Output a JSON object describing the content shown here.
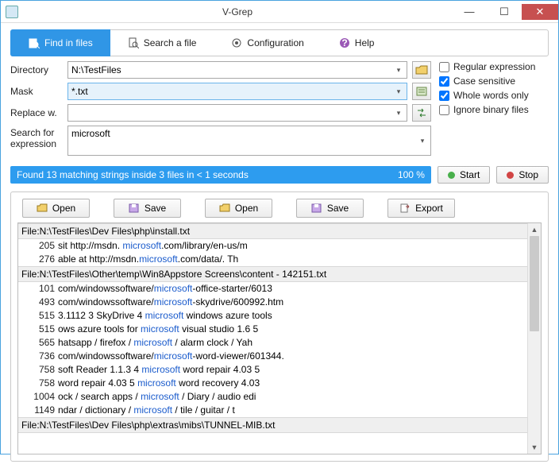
{
  "window": {
    "title": "V-Grep"
  },
  "toolbar": {
    "find_in_files": "Find in files",
    "search_a_file": "Search a file",
    "configuration": "Configuration",
    "help": "Help"
  },
  "form": {
    "directory_label": "Directory",
    "directory_value": "N:\\TestFiles",
    "mask_label": "Mask",
    "mask_value": "*.txt",
    "replace_label": "Replace w.",
    "replace_value": "",
    "search_label": "Search for expression",
    "search_value": "microsoft"
  },
  "options": {
    "regex": {
      "label": "Regular expression",
      "checked": false
    },
    "case_sensitive": {
      "label": "Case sensitive",
      "checked": true
    },
    "whole_words": {
      "label": "Whole words only",
      "checked": true
    },
    "ignore_binary": {
      "label": "Ignore binary files",
      "checked": false
    }
  },
  "status": {
    "message": "Found 13 matching strings inside 3 files in < 1 seconds",
    "percent": "100 %"
  },
  "buttons": {
    "start": "Start",
    "stop": "Stop",
    "open": "Open",
    "save": "Save",
    "export": "Export"
  },
  "results": {
    "groups": [
      {
        "file": "File:N:\\TestFiles\\Dev Files\\php\\install.txt",
        "lines": [
          {
            "n": "205",
            "pre": "sit   http://msdn.  ",
            "match": "microsoft",
            "post": ".com/library/en-us/m"
          },
          {
            "n": "276",
            "pre": "able at http://msdn.",
            "match": "microsoft",
            "post": ".com/data/.   Th"
          }
        ]
      },
      {
        "file": "File:N:\\TestFiles\\Other\\temp\\Win8Appstore Screens\\content - 142151.txt",
        "lines": [
          {
            "n": "101",
            "pre": "com/windowssoftware/",
            "match": "microsoft",
            "post": "-office-starter/6013"
          },
          {
            "n": "493",
            "pre": "com/windowssoftware/",
            "match": "microsoft",
            "post": "-skydrive/600992.htm"
          },
          {
            "n": "515",
            "pre": "3.1112 3 SkyDrive 4 ",
            "match": "microsoft",
            "post": " windows azure tools"
          },
          {
            "n": "515",
            "pre": "ows azure tools for ",
            "match": "microsoft",
            "post": " visual studio 1.6 5"
          },
          {
            "n": "565",
            "pre": "hatsapp / firefox / ",
            "match": "microsoft",
            "post": " / alarm clock / Yah"
          },
          {
            "n": "736",
            "pre": "com/windowssoftware/",
            "match": "microsoft",
            "post": "-word-viewer/601344."
          },
          {
            "n": "758",
            "pre": "soft Reader 1.1.3 4 ",
            "match": "microsoft",
            "post": " word repair 4.03 5"
          },
          {
            "n": "758",
            "pre": " word repair 4.03 5 ",
            "match": "microsoft",
            "post": " word recovery 4.03"
          },
          {
            "n": "1004",
            "pre": "ock / search apps / ",
            "match": "microsoft",
            "post": " / Diary / audio edi"
          },
          {
            "n": "1149",
            "pre": "ndar / dictionary / ",
            "match": "microsoft",
            "post": " / tile / guitar / t"
          }
        ]
      },
      {
        "file": "File:N:\\TestFiles\\Dev Files\\php\\extras\\mibs\\TUNNEL-MIB.txt",
        "lines": []
      }
    ]
  }
}
